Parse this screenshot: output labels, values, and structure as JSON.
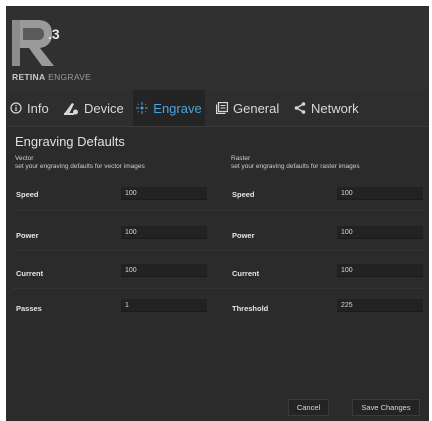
{
  "brand": {
    "version": ".3",
    "name_bold": "RETINA",
    "name_light": " ENGRAVE"
  },
  "tabs": [
    {
      "label": "Info",
      "icon": "info-icon",
      "active": false
    },
    {
      "label": "Device",
      "icon": "device-icon",
      "active": false
    },
    {
      "label": "Engrave",
      "icon": "engrave-icon",
      "active": true
    },
    {
      "label": "General",
      "icon": "general-icon",
      "active": false
    },
    {
      "label": "Network",
      "icon": "share-icon",
      "active": false
    }
  ],
  "colors": {
    "accent": "#4aa3df",
    "background": "#2b2b2b",
    "input": "#222222"
  },
  "section_title": "Engraving Defaults",
  "vector": {
    "title": "Vector",
    "subtitle": "set your engraving defaults for vector images",
    "fields": [
      {
        "label": "Speed",
        "value": "100"
      },
      {
        "label": "Power",
        "value": "100"
      },
      {
        "label": "Current",
        "value": "100"
      },
      {
        "label": "Passes",
        "value": "1"
      }
    ]
  },
  "raster": {
    "title": "Raster",
    "subtitle": "set your engraving defaults for raster images",
    "fields": [
      {
        "label": "Speed",
        "value": "100"
      },
      {
        "label": "Power",
        "value": "100"
      },
      {
        "label": "Current",
        "value": "100"
      },
      {
        "label": "Threshold",
        "value": "225"
      }
    ]
  },
  "buttons": {
    "cancel": "Cancel",
    "save": "Save Changes"
  }
}
